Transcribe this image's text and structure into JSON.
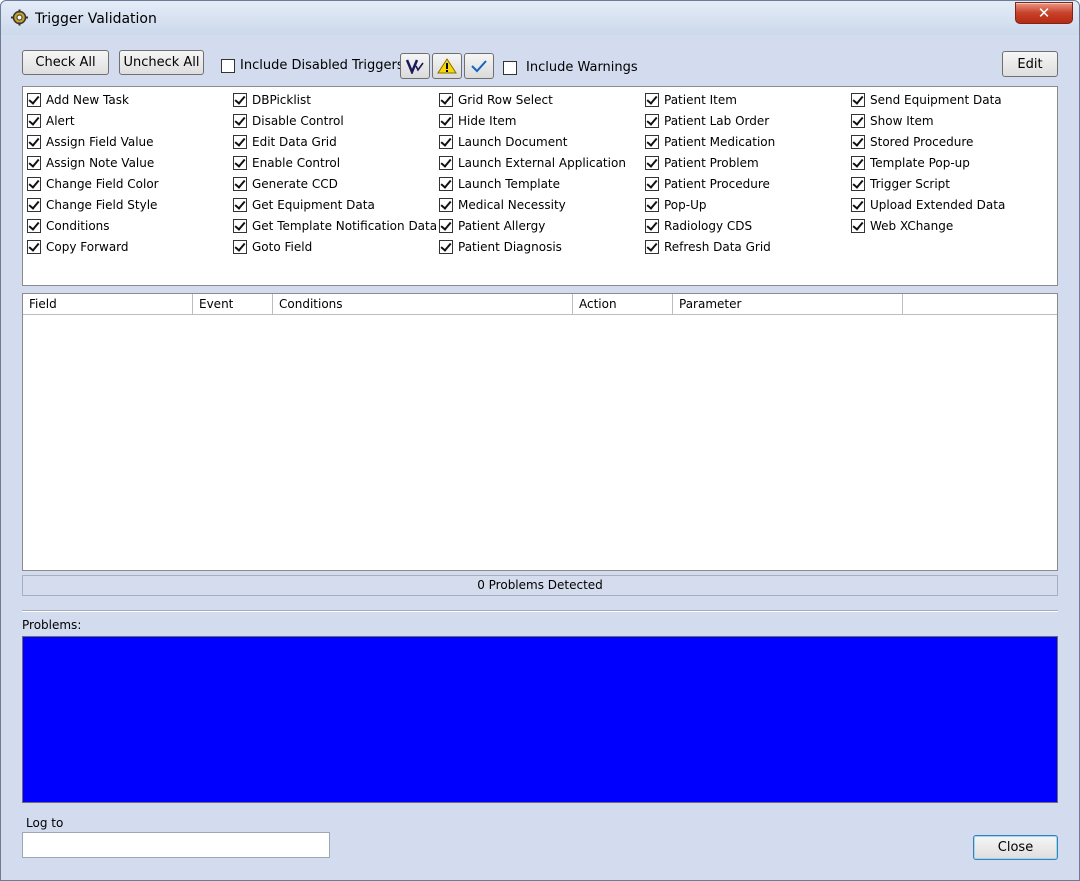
{
  "window": {
    "title": "Trigger Validation",
    "close_glyph": "✕"
  },
  "toolbar": {
    "check_all": "Check All",
    "uncheck_all": "Uncheck All",
    "include_disabled_label": "Include Disabled Triggers",
    "include_disabled_checked": false,
    "include_warnings_label": "Include Warnings",
    "include_warnings_checked": false,
    "edit": "Edit",
    "icons": [
      "validate-icon",
      "warning-icon",
      "checkmark-icon"
    ]
  },
  "triggers": {
    "columns": [
      [
        "Add New Task",
        "Alert",
        "Assign Field Value",
        "Assign Note Value",
        "Change Field Color",
        "Change Field Style",
        "Conditions",
        "Copy Forward"
      ],
      [
        "DBPicklist",
        "Disable Control",
        "Edit Data Grid",
        "Enable Control",
        "Generate CCD",
        "Get Equipment Data",
        "Get Template Notification Data",
        "Goto Field"
      ],
      [
        "Grid Row Select",
        "Hide Item",
        "Launch Document",
        "Launch External Application",
        "Launch Template",
        "Medical Necessity",
        "Patient Allergy",
        "Patient Diagnosis"
      ],
      [
        "Patient Item",
        "Patient Lab Order",
        "Patient Medication",
        "Patient Problem",
        "Patient Procedure",
        "Pop-Up",
        "Radiology CDS",
        "Refresh Data Grid"
      ],
      [
        "Send Equipment Data",
        "Show Item",
        "Stored Procedure",
        "Template Pop-up",
        "Trigger Script",
        "Upload Extended Data",
        "Web XChange"
      ]
    ]
  },
  "grid": {
    "headers": [
      "Field",
      "Event",
      "Conditions",
      "Action",
      "Parameter"
    ]
  },
  "status": {
    "text": "0 Problems Detected"
  },
  "problems": {
    "label": "Problems:",
    "background": "#0000ff"
  },
  "log": {
    "label": "Log to",
    "value": ""
  },
  "footer": {
    "close": "Close"
  }
}
